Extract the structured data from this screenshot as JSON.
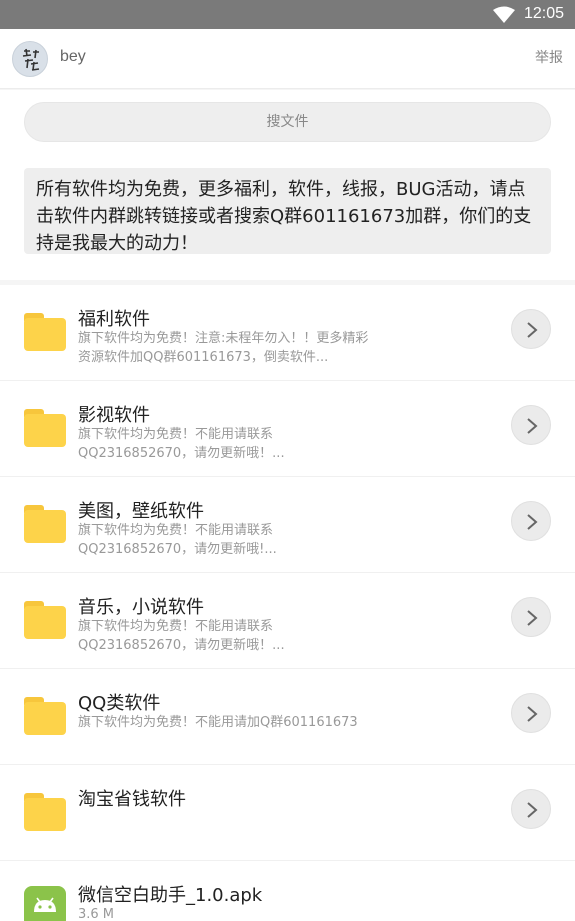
{
  "status_bar": {
    "time": "12:05",
    "wifi_icon": "wifi-icon"
  },
  "header": {
    "username": "bey",
    "report_label": "举报",
    "avatar_icon": "avatar-icon"
  },
  "search": {
    "placeholder": "搜文件"
  },
  "notice": {
    "text": "所有软件均为免费，更多福利，软件，线报，BUG活动，请点击软件内群跳转链接或者搜索Q群601161673加群，你们的支持是我最大的动力！"
  },
  "items": [
    {
      "title": "福利软件",
      "desc": "旗下软件均为免费！注意:未程年勿入！！更多精彩资源软件加QQ群601161673，倒卖软件...",
      "icon": "folder-icon"
    },
    {
      "title": "影视软件",
      "desc": "旗下软件均为免费！不能用请联系QQ2316852670，请勿更新哦！...",
      "icon": "folder-icon"
    },
    {
      "title": "美图，壁纸软件",
      "desc": "旗下软件均为免费！不能用请联系QQ2316852670，请勿更新哦!...",
      "icon": "folder-icon"
    },
    {
      "title": "音乐，小说软件",
      "desc": "旗下软件均为免费！不能用请联系QQ2316852670，请勿更新哦！...",
      "icon": "folder-icon"
    },
    {
      "title": "QQ类软件",
      "desc": "旗下软件均为免费！不能用请加Q群601161673",
      "icon": "folder-icon"
    },
    {
      "title": "淘宝省钱软件",
      "desc": "",
      "icon": "folder-icon"
    }
  ],
  "apk": {
    "title": "微信空白助手_1.0.apk",
    "size": "3.6 M",
    "icon": "android-icon"
  },
  "colors": {
    "folder": "#fdd34a",
    "statusbar": "#7a7a7a",
    "android": "#8bc34a"
  }
}
